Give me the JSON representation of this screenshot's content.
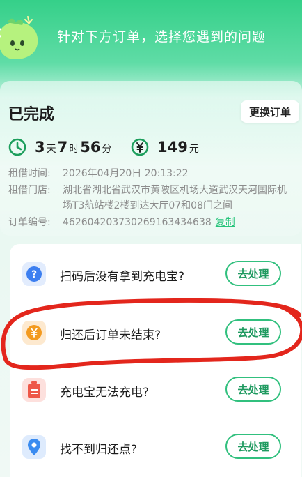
{
  "header": {
    "title": "针对下方订单，选择您遇到的问题"
  },
  "order": {
    "status": "已完成",
    "change_button": "更换订单",
    "duration": {
      "days": "3",
      "days_unit": "天",
      "hours": "7",
      "hours_unit": "时",
      "minutes": "56",
      "minutes_unit": "分"
    },
    "fee": {
      "amount": "149",
      "unit": "元"
    },
    "rent_time_label": "租借时间:",
    "rent_time": "2026年04月20日 20:13:22",
    "store_label": "租借门店:",
    "store": "湖北省湖北省武汉市黄陂区机场大道武汉天河国际机场T3航站楼2楼到达大厅07和08门之间",
    "order_no_label": "订单编号:",
    "order_no": "462604203730269163434638",
    "copy_label": "复制"
  },
  "questions": [
    {
      "label": "扫码后没有拿到充电宝?",
      "icon": "question-icon",
      "button": "去处理",
      "color": "#3d7ff0"
    },
    {
      "label": "归还后订单未结束?",
      "icon": "yuan-coin-icon",
      "button": "去处理",
      "color": "#f39a1f"
    },
    {
      "label": "充电宝无法充电?",
      "icon": "battery-icon",
      "button": "去处理",
      "color": "#ee5748"
    },
    {
      "label": "找不到归还点?",
      "icon": "location-pin-icon",
      "button": "去处理",
      "color": "#3b8cf0"
    }
  ],
  "colors": {
    "brand_green": "#31c07e",
    "annotation_red": "#e3261c"
  }
}
